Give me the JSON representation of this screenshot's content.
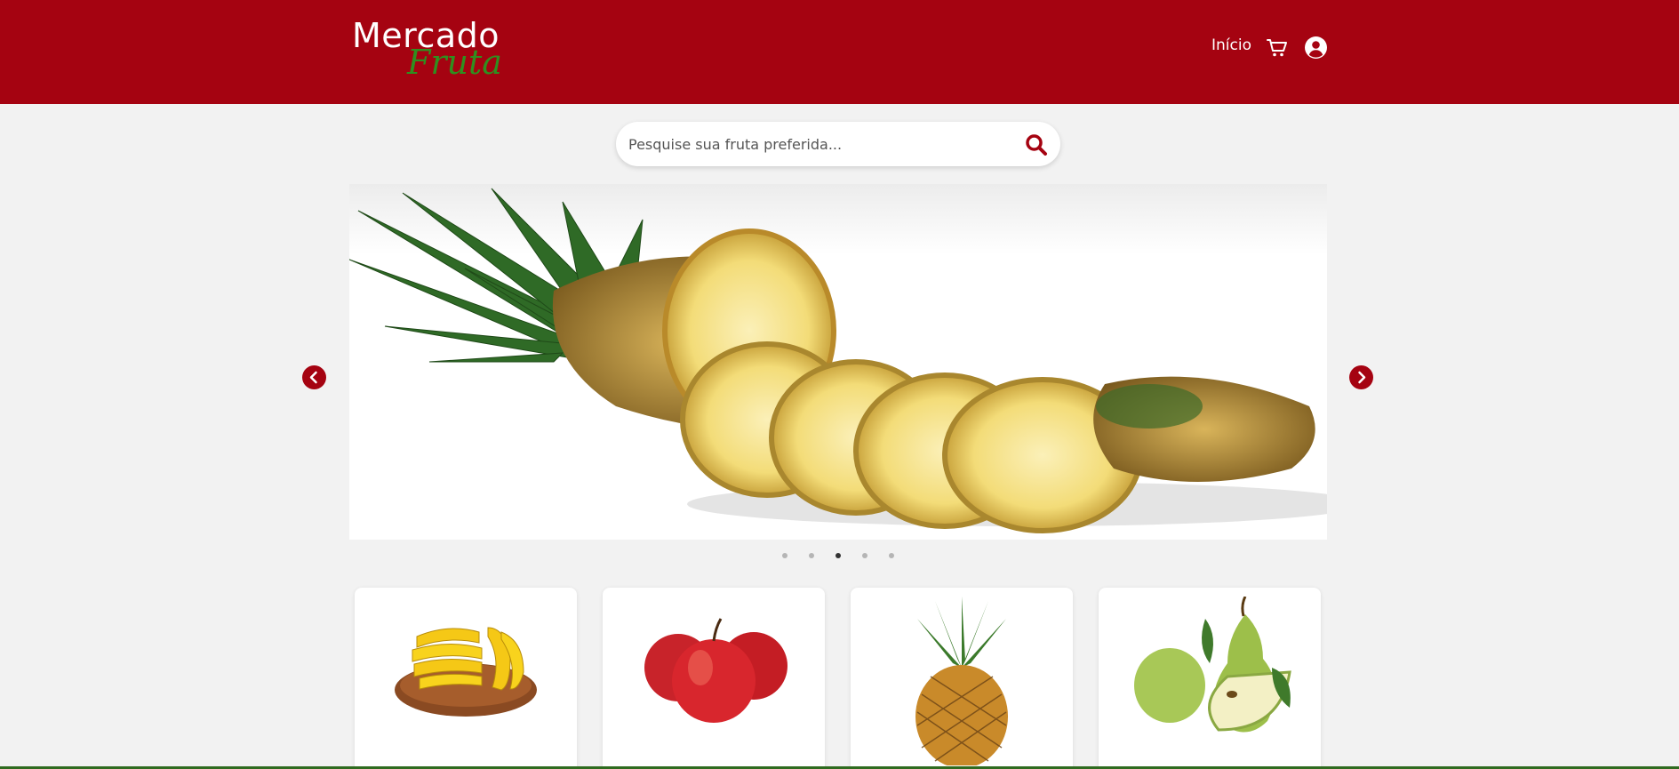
{
  "header": {
    "logo_line1": "Mercado",
    "logo_line2": "Fruta",
    "nav_home": "Início",
    "cart_icon": "cart-icon",
    "user_icon": "user-circle-icon",
    "brand_color": "#a50311",
    "logo_accent": "#2f8f1f"
  },
  "search": {
    "placeholder": "Pesquise sua fruta preferida...",
    "value": "",
    "icon": "search-icon"
  },
  "carousel": {
    "current_slide": "pineapple",
    "slide_count": 5,
    "active_index": 3,
    "prev_icon": "chevron-left-icon",
    "next_icon": "chevron-right-icon"
  },
  "products": [
    {
      "name": "banana"
    },
    {
      "name": "apple"
    },
    {
      "name": "pineapple"
    },
    {
      "name": "pear"
    }
  ]
}
